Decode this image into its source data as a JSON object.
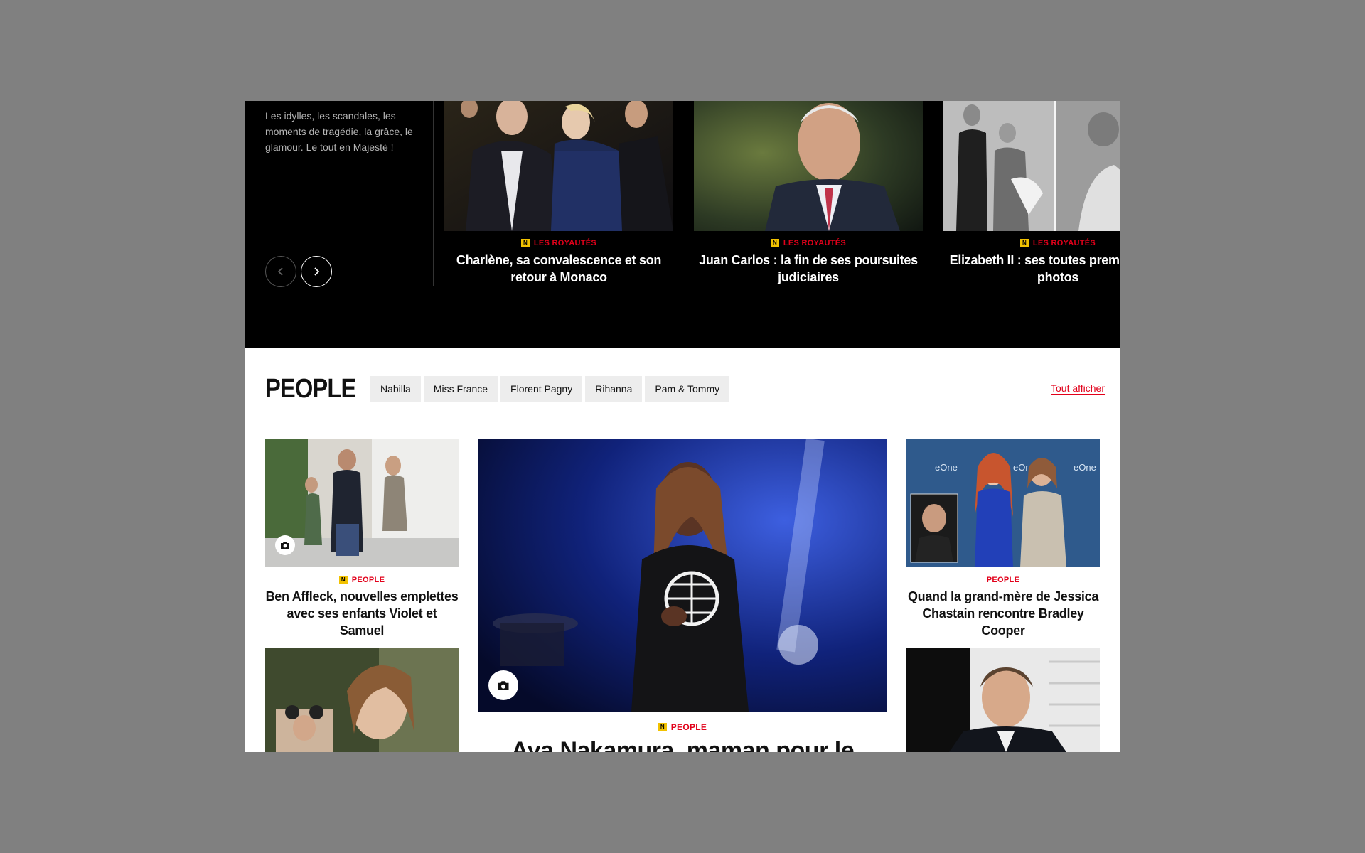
{
  "royal": {
    "intro": "Les idylles, les scandales, les moments de tragédie, la grâce, le glamour. Le tout en Majesté !",
    "cards": [
      {
        "category": "LES ROYAUTÉS",
        "title": "Charlène, sa convalescence et son retour à Monaco"
      },
      {
        "category": "LES ROYAUTÉS",
        "title": "Juan Carlos :  la fin de ses poursuites judiciaires"
      },
      {
        "category": "LES ROYAUTÉS",
        "title": "Elizabeth II : ses toutes premières en photos"
      }
    ]
  },
  "people": {
    "title": "PEOPLE",
    "tags": [
      "Nabilla",
      "Miss France",
      "Florent Pagny",
      "Rihanna",
      "Pam & Tommy"
    ],
    "see_all": "Tout afficher",
    "cards": {
      "left_top": {
        "category": "PEOPLE",
        "title": "Ben Affleck, nouvelles emplettes avec ses enfants Violet et Samuel"
      },
      "center": {
        "category": "PEOPLE",
        "title": "Aya Nakamura, maman pour le"
      },
      "right_top": {
        "category": "PEOPLE",
        "title": "Quand la grand-mère de Jessica Chastain rencontre Bradley Cooper"
      }
    }
  },
  "colors": {
    "accent": "#e2001a",
    "badge": "#f2c200",
    "band": "#000000",
    "backdrop": "#808080"
  },
  "icons": [
    "chevron-left-icon",
    "chevron-right-icon",
    "camera-icon",
    "badge-n-icon"
  ]
}
